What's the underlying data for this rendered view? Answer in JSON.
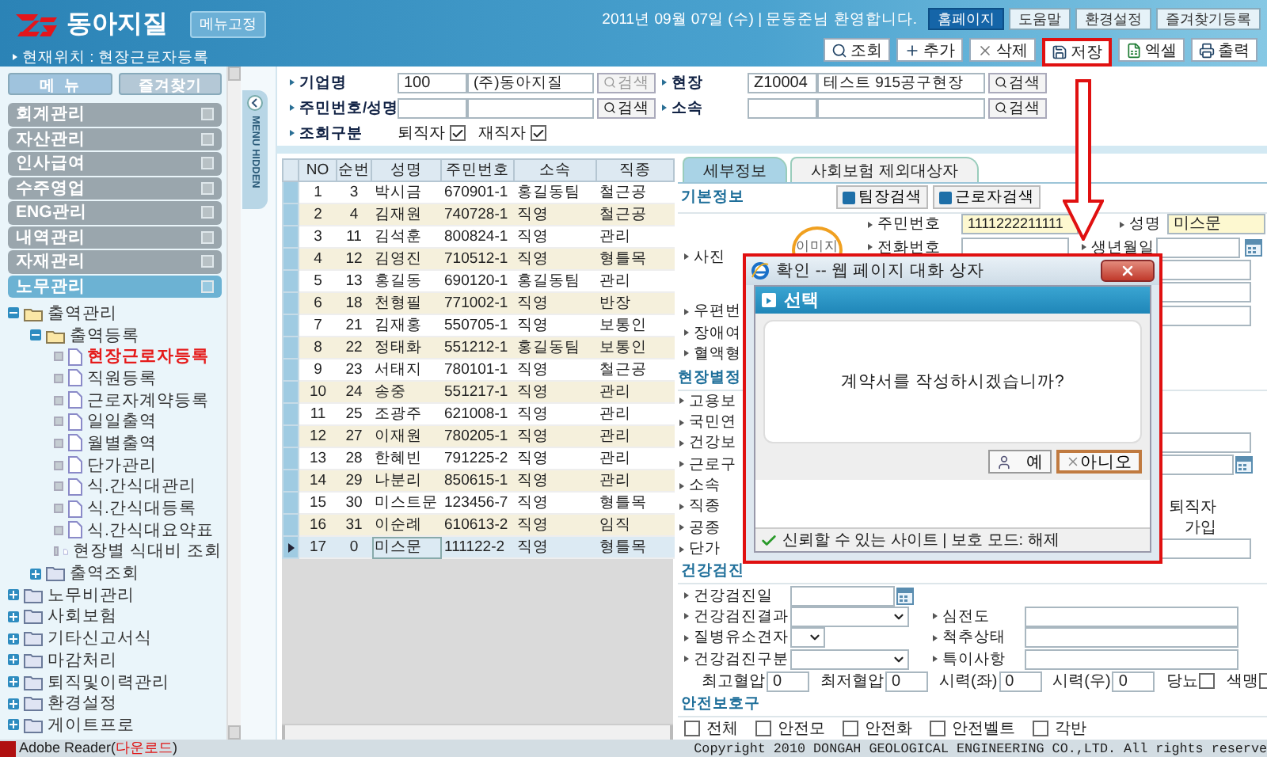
{
  "header": {
    "brand": "동아지질",
    "pin_button": "메뉴고정",
    "location": "현재위치 : 현장근로자등록",
    "greeting": "2011년 09월 07일 (수) | 문동준님 환영합니다.",
    "links": [
      {
        "label": "홈페이지",
        "selected": true
      },
      {
        "label": "도움말",
        "selected": false
      },
      {
        "label": "환경설정",
        "selected": false
      },
      {
        "label": "즐겨찾기등록",
        "selected": false
      }
    ],
    "actions": [
      {
        "label": "조회",
        "kind": "search",
        "annotated": false
      },
      {
        "label": "추가",
        "kind": "add",
        "annotated": false
      },
      {
        "label": "삭제",
        "kind": "delete",
        "annotated": false
      },
      {
        "label": "저장",
        "kind": "save",
        "annotated": true
      },
      {
        "label": "엑셀",
        "kind": "excel",
        "annotated": false
      },
      {
        "label": "출력",
        "kind": "print",
        "annotated": false
      }
    ]
  },
  "search": {
    "fields": [
      {
        "label": "기업명",
        "code": "100",
        "name": "(주)동아지질",
        "button": "검색",
        "disabled": true
      },
      {
        "label": "현장",
        "code": "Z10004",
        "name": "테스트 915공구현장",
        "button": "검색",
        "disabled": false
      },
      {
        "label": "주민번호/성명",
        "button": "검색",
        "disabled": false
      },
      {
        "label": "소속",
        "button": "검색",
        "disabled": false
      }
    ],
    "filter": {
      "label": "조회구분",
      "options": [
        {
          "label": "퇴직자",
          "checked": true
        },
        {
          "label": "재직자",
          "checked": true
        }
      ]
    }
  },
  "sidebar": {
    "buttons": [
      {
        "label": "메  뉴",
        "selected": true
      },
      {
        "label": "즐겨찾기",
        "selected": false
      }
    ],
    "categories": [
      {
        "label": "회계관리",
        "expanded": false
      },
      {
        "label": "자산관리",
        "expanded": false
      },
      {
        "label": "인사급여",
        "expanded": false
      },
      {
        "label": "수주영업",
        "expanded": false
      },
      {
        "label": "ENG관리",
        "expanded": false
      },
      {
        "label": "내역관리",
        "expanded": false
      },
      {
        "label": "자재관리",
        "expanded": false
      },
      {
        "label": "노무관리",
        "expanded": true
      }
    ],
    "tree": [
      {
        "label": "출역관리",
        "kind": "folder",
        "expanded": true,
        "children": [
          {
            "label": "출역등록",
            "kind": "folder",
            "expanded": true,
            "children": [
              {
                "label": "현장근로자등록",
                "kind": "page",
                "selected": true
              },
              {
                "label": "직원등록",
                "kind": "page",
                "selected": false
              },
              {
                "label": "근로자계약등록",
                "kind": "page",
                "selected": false
              },
              {
                "label": "일일출역",
                "kind": "page",
                "selected": false
              },
              {
                "label": "월별출역",
                "kind": "page",
                "selected": false
              },
              {
                "label": "단가관리",
                "kind": "page",
                "selected": false
              },
              {
                "label": "식.간식대관리",
                "kind": "page",
                "selected": false
              },
              {
                "label": "식.간식대등록",
                "kind": "page",
                "selected": false
              },
              {
                "label": "식.간식대요약표",
                "kind": "page",
                "selected": false
              },
              {
                "label": "현장별 식대비 조회",
                "kind": "page",
                "selected": false
              }
            ]
          },
          {
            "label": "출역조회",
            "kind": "folder",
            "expanded": false
          }
        ]
      },
      {
        "label": "노무비관리",
        "kind": "folder",
        "expanded": false
      },
      {
        "label": "사회보험",
        "kind": "folder",
        "expanded": false
      },
      {
        "label": "기타신고서식",
        "kind": "folder",
        "expanded": false
      },
      {
        "label": "마감처리",
        "kind": "folder",
        "expanded": false
      },
      {
        "label": "퇴직및이력관리",
        "kind": "folder",
        "expanded": false
      },
      {
        "label": "환경설정",
        "kind": "folder",
        "expanded": false
      },
      {
        "label": "게이트프로",
        "kind": "folder",
        "expanded": false
      }
    ],
    "side_tab": "MENU HIDDEN"
  },
  "table": {
    "columns": [
      "NO",
      "순번",
      "성명",
      "주민번호",
      "소속",
      "직종"
    ],
    "rows": [
      {
        "cells": [
          "1",
          "3",
          "박시금",
          "670901-1",
          "홍길동팀",
          "철근공"
        ],
        "selected": false
      },
      {
        "cells": [
          "2",
          "4",
          "김재원",
          "740728-1",
          "직영",
          "철근공"
        ],
        "selected": false
      },
      {
        "cells": [
          "3",
          "11",
          "김석훈",
          "800824-1",
          "직영",
          "관리"
        ],
        "selected": false
      },
      {
        "cells": [
          "4",
          "12",
          "김영진",
          "710512-1",
          "직영",
          "형틀목"
        ],
        "selected": false
      },
      {
        "cells": [
          "5",
          "13",
          "홍길동",
          "690120-1",
          "홍길동팀",
          "관리"
        ],
        "selected": false
      },
      {
        "cells": [
          "6",
          "18",
          "천형필",
          "771002-1",
          "직영",
          "반장"
        ],
        "selected": false
      },
      {
        "cells": [
          "7",
          "21",
          "김재홍",
          "550705-1",
          "직영",
          "보통인"
        ],
        "selected": false
      },
      {
        "cells": [
          "8",
          "22",
          "정태화",
          "551212-1",
          "홍길동팀",
          "보통인"
        ],
        "selected": false
      },
      {
        "cells": [
          "9",
          "23",
          "서태지",
          "780101-1",
          "직영",
          "철근공"
        ],
        "selected": false
      },
      {
        "cells": [
          "10",
          "24",
          "송중",
          "551217-1",
          "직영",
          "관리"
        ],
        "selected": false
      },
      {
        "cells": [
          "11",
          "25",
          "조광주",
          "621008-1",
          "직영",
          "관리"
        ],
        "selected": false
      },
      {
        "cells": [
          "12",
          "27",
          "이재원",
          "780205-1",
          "직영",
          "관리"
        ],
        "selected": false
      },
      {
        "cells": [
          "13",
          "28",
          "한혜빈",
          "791225-2",
          "직영",
          "관리"
        ],
        "selected": false
      },
      {
        "cells": [
          "14",
          "29",
          "나분리",
          "850615-1",
          "직영",
          "관리"
        ],
        "selected": false
      },
      {
        "cells": [
          "15",
          "30",
          "미스트문",
          "123456-7",
          "직영",
          "형틀목"
        ],
        "selected": false
      },
      {
        "cells": [
          "16",
          "31",
          "이순례",
          "610613-2",
          "직영",
          "임직"
        ],
        "selected": false
      },
      {
        "cells": [
          "17",
          "0",
          "미스문",
          "111122-2",
          "직영",
          "형틀목"
        ],
        "selected": true
      }
    ]
  },
  "detail": {
    "tabs": [
      {
        "label": "세부정보",
        "selected": true
      },
      {
        "label": "사회보험 제외대상자",
        "selected": false
      }
    ],
    "basic": {
      "heading": "기본정보",
      "buttons": [
        "팀장검색",
        "근로자검색"
      ],
      "photo_label": "사진",
      "photo_badge": "이미지",
      "id": {
        "label": "주민번호",
        "value": "1111222211111"
      },
      "name": {
        "label": "성명",
        "value": "미스문"
      },
      "phone": {
        "label": "전화번호"
      },
      "birth": {
        "label": "생년월일"
      },
      "side_fields": [
        {
          "kind": "input"
        },
        {
          "kind": "input"
        },
        {
          "kind": "input"
        }
      ],
      "lower_labels": [
        "우편번",
        "장애여",
        "혈액형"
      ]
    },
    "site": {
      "heading": "현장별정",
      "rows": [
        {
          "label": "고용보",
          "kind": "none"
        },
        {
          "label": "국민연",
          "kind": "none"
        },
        {
          "label": "건강보",
          "kind": "input"
        },
        {
          "label": "근로구",
          "kind": "date"
        },
        {
          "label": "소속",
          "kind": "none"
        },
        {
          "label": "직종",
          "kind": "text",
          "text": "퇴직자"
        },
        {
          "label": "공종",
          "kind": "text",
          "text": "가입"
        },
        {
          "label": "단가",
          "kind": "input"
        }
      ]
    },
    "health": {
      "heading": "건강검진",
      "fields": [
        {
          "label": "건강검진일",
          "kind": "date"
        },
        {
          "label": "건강검진결과",
          "kind": "select"
        },
        {
          "label": "질병유소견자",
          "kind": "small-select"
        },
        {
          "label": "건강검진구분",
          "kind": "select"
        }
      ],
      "notes": [
        "심전도",
        "척추상태",
        "특이사항"
      ],
      "measures": [
        {
          "label": "최고혈압",
          "kind": "number",
          "value": "0"
        },
        {
          "label": "최저혈압",
          "kind": "number",
          "value": "0"
        },
        {
          "label": "시력(좌)",
          "kind": "number",
          "value": "0"
        },
        {
          "label": "시력(우)",
          "kind": "number",
          "value": "0"
        },
        {
          "label": "당뇨",
          "kind": "check",
          "checked": false
        },
        {
          "label": "색맹",
          "kind": "check",
          "checked": false
        }
      ]
    },
    "safety": {
      "heading": "안전보호구",
      "items": [
        {
          "label": "전체",
          "checked": false
        },
        {
          "label": "안전모",
          "checked": false
        },
        {
          "label": "안전화",
          "checked": false
        },
        {
          "label": "안전벨트",
          "checked": false
        },
        {
          "label": "각반",
          "checked": false
        }
      ]
    }
  },
  "dialog": {
    "title": "확인 -- 웹 페이지 대화 상자",
    "heading": "선택",
    "message": "계약서를 작성하시겠습니까?",
    "annotated": true,
    "buttons": [
      {
        "label": "예",
        "kind": "confirm",
        "focused": false
      },
      {
        "label": "아니오",
        "kind": "cancel",
        "focused": true
      }
    ],
    "status": "신뢰할 수 있는 사이트 | 보호 모드: 해제"
  },
  "footer": {
    "reader": "Adobe Reader(",
    "reader_link": "다운로드",
    "reader_end": ")",
    "copyright": "Copyright 2010 DONGAH GEOLOGICAL ENGINEERING CO.,LTD. All rights reserve"
  }
}
